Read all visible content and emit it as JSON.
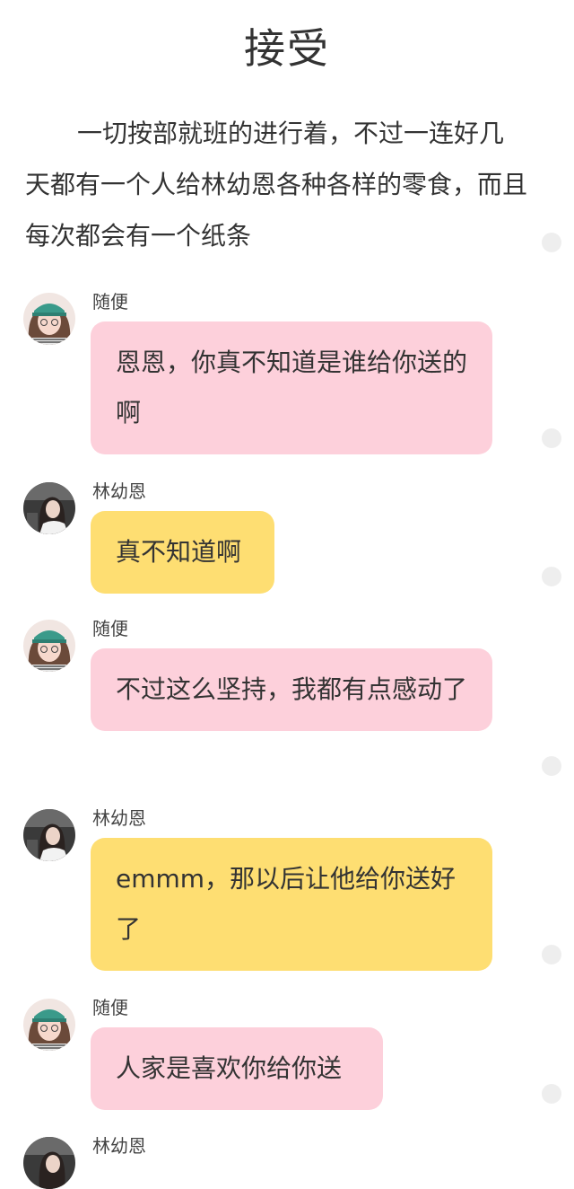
{
  "title": "接受",
  "narration": "一切按部就班的进行着，不过一连好几天都有一个人给林幼恩各种各样的零食，而且每次都会有一个纸条",
  "messages": [
    {
      "sender": "随便",
      "text": "恩恩，你真不知道是谁给你送的啊",
      "bubble_color": "#fdd0db",
      "avatar": "avatar-suibian"
    },
    {
      "sender": "林幼恩",
      "text": "真不知道啊",
      "bubble_color": "#fede72",
      "avatar": "avatar-linyouen"
    },
    {
      "sender": "随便",
      "text": "不过这么坚持，我都有点感动了",
      "bubble_color": "#fdd0db",
      "avatar": "avatar-suibian"
    },
    {
      "sender": "林幼恩",
      "text": "emmm，那以后让他给你送好了",
      "bubble_color": "#fede72",
      "avatar": "avatar-linyouen"
    },
    {
      "sender": "随便",
      "text": "人家是喜欢你给你送",
      "bubble_color": "#fdd0db",
      "avatar": "avatar-suibian"
    },
    {
      "sender": "林幼恩",
      "text": "",
      "bubble_color": "#fede72",
      "avatar": "avatar-linyouen"
    }
  ]
}
